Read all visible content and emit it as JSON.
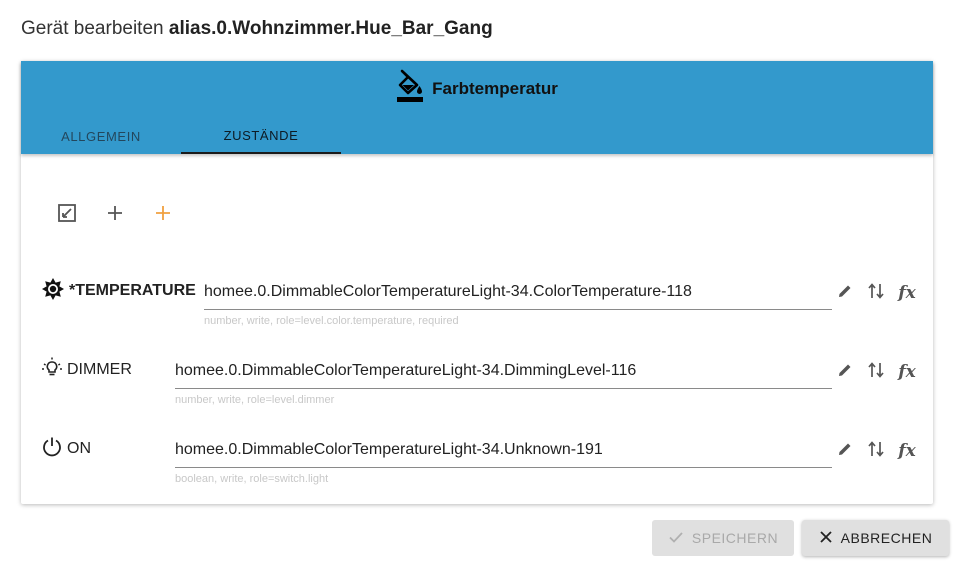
{
  "dialog": {
    "title_prefix": "Gerät bearbeiten",
    "alias": "alias.0.Wohnzimmer.Hue_Bar_Gang"
  },
  "device": {
    "type_icon": "paint-bucket-icon",
    "type_label": "Farbtemperatur"
  },
  "tabs": [
    {
      "label": "ALLGEMEIN",
      "active": false
    },
    {
      "label": "ZUSTÄNDE",
      "active": true
    }
  ],
  "toolbar": {
    "icons": [
      "expand-icon",
      "plus-icon",
      "plus-orange-icon"
    ],
    "accent": "#f0a040"
  },
  "states": [
    {
      "prefix": "*",
      "name": "TEMPERATURE",
      "icon": "brightness-icon",
      "value": "homee.0.DimmableColorTemperatureLight-34.ColorTemperature-118",
      "hint": "number, write, role=level.color.temperature, required"
    },
    {
      "prefix": "",
      "name": "DIMMER",
      "icon": "lightbulb-icon",
      "value": "homee.0.DimmableColorTemperatureLight-34.DimmingLevel-116",
      "hint": "number, write, role=level.dimmer"
    },
    {
      "prefix": "",
      "name": "ON",
      "icon": "power-icon",
      "value": "homee.0.DimmableColorTemperatureLight-34.Unknown-191",
      "hint": "boolean, write, role=switch.light"
    }
  ],
  "buttons": {
    "save": "SPEICHERN",
    "cancel": "ABBRECHEN"
  },
  "colors": {
    "header": "#3399cc",
    "button_bg": "#e0e0e0"
  }
}
